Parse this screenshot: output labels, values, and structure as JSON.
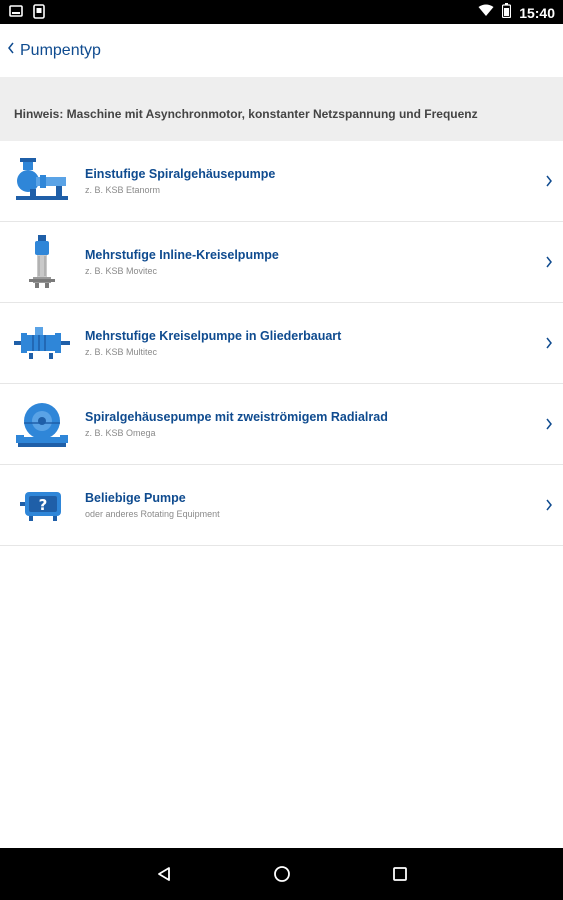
{
  "status_bar": {
    "time": "15:40"
  },
  "header": {
    "title": "Pumpentyp"
  },
  "hint": {
    "text": "Hinweis: Maschine mit Asynchronmotor, konstanter Netzspannung und Frequenz"
  },
  "items": [
    {
      "title": "Einstufige Spiralgehäusepumpe",
      "subtitle": "z. B. KSB Etanorm",
      "icon": "end-suction-pump-icon"
    },
    {
      "title": "Mehrstufige Inline-Kreiselpumpe",
      "subtitle": "z. B. KSB Movitec",
      "icon": "inline-pump-icon"
    },
    {
      "title": "Mehrstufige Kreiselpumpe in Gliederbauart",
      "subtitle": "z. B. KSB Multitec",
      "icon": "ring-section-pump-icon"
    },
    {
      "title": "Spiralgehäusepumpe mit zweiströmigem Radialrad",
      "subtitle": "z. B. KSB Omega",
      "icon": "split-case-pump-icon"
    },
    {
      "title": "Beliebige Pumpe",
      "subtitle": "oder anderes Rotating Equipment",
      "icon": "unknown-pump-icon"
    }
  ],
  "colors": {
    "accent": "#0f4b8f",
    "pump_blue": "#2f86d8",
    "hint_bg": "#eeeeee"
  }
}
